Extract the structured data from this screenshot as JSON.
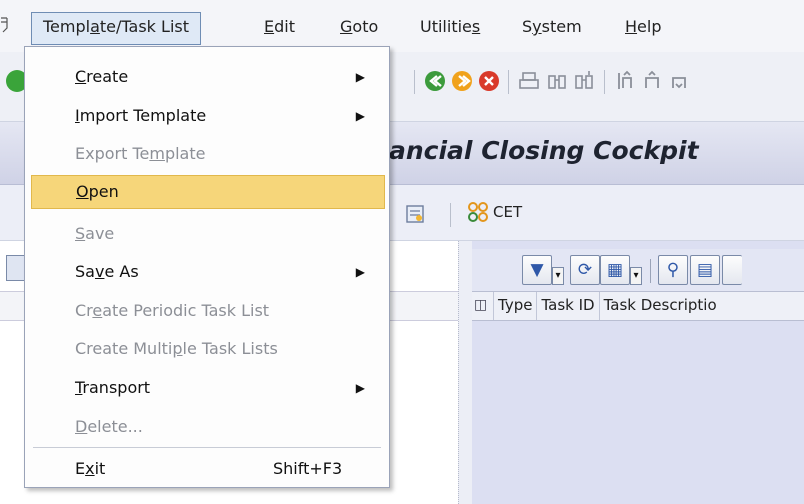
{
  "menubar": {
    "items": [
      {
        "pre": "Templ",
        "key": "a",
        "post": "te/Task List",
        "active": true
      },
      {
        "pre": "",
        "key": "E",
        "post": "dit"
      },
      {
        "pre": "",
        "key": "G",
        "post": "oto"
      },
      {
        "pre": "Utilitie",
        "key": "s",
        "post": ""
      },
      {
        "pre": "S",
        "key": "y",
        "post": "stem"
      },
      {
        "pre": "",
        "key": "H",
        "post": "elp"
      }
    ]
  },
  "title": {
    "partial": "ancial Closing Cockpit"
  },
  "app_toolbar": {
    "cet_label": "CET"
  },
  "grid": {
    "columns": [
      "Type",
      "Task ID",
      "Task Descriptio"
    ]
  },
  "menu": {
    "items": [
      {
        "pre": "",
        "key": "C",
        "post": "reate",
        "submenu": true,
        "disabled": false
      },
      {
        "pre": "",
        "key": "I",
        "post": "mport Template",
        "submenu": true,
        "disabled": false
      },
      {
        "pre": "Export Te",
        "key": "m",
        "post": "plate",
        "submenu": false,
        "disabled": true
      },
      {
        "pre": "",
        "key": "O",
        "post": "pen",
        "submenu": false,
        "disabled": false,
        "highlight": true
      },
      {
        "pre": "",
        "key": "S",
        "post": "ave",
        "submenu": false,
        "disabled": true
      },
      {
        "pre": "Sa",
        "key": "v",
        "post": "e As",
        "submenu": true,
        "disabled": false
      },
      {
        "pre": "Cr",
        "key": "e",
        "post": "ate Periodic Task List",
        "submenu": false,
        "disabled": true
      },
      {
        "pre": "Create Multi",
        "key": "p",
        "post": "le Task Lists",
        "submenu": false,
        "disabled": true
      },
      {
        "pre": "",
        "key": "T",
        "post": "ransport",
        "submenu": true,
        "disabled": false
      },
      {
        "pre": "",
        "key": "D",
        "post": "elete...",
        "submenu": false,
        "disabled": true
      },
      {
        "pre": "E",
        "key": "x",
        "post": "it",
        "submenu": false,
        "disabled": false,
        "shortcut": "Shift+F3"
      }
    ]
  },
  "colors": {
    "highlight": "#f6d67a",
    "menu_active": "#dfe9f6",
    "disabled_text": "#8c8f96",
    "title_bar": "#d6d9ea"
  }
}
